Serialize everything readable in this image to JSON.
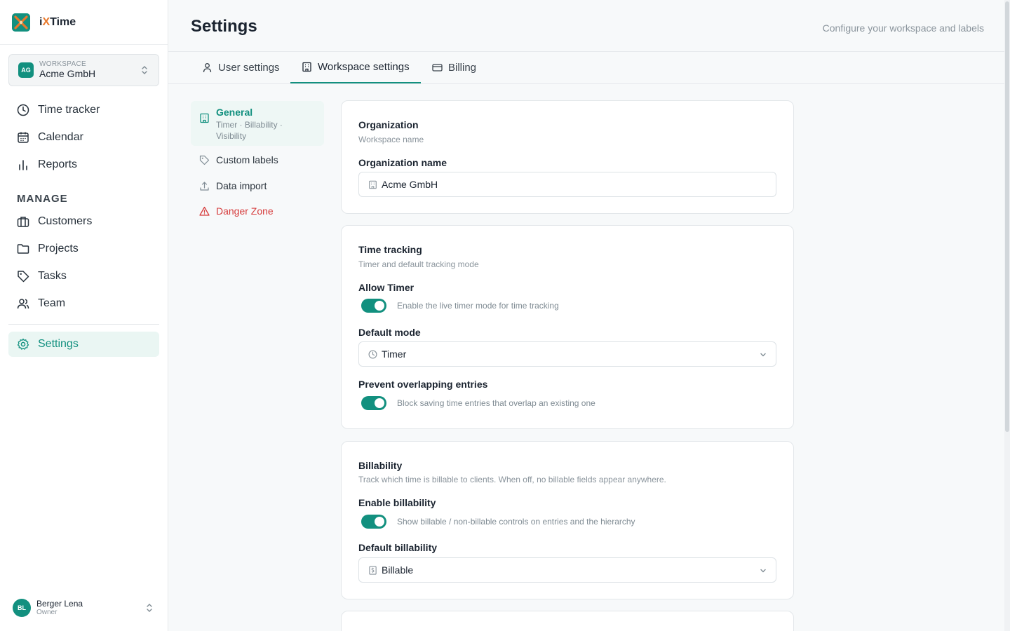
{
  "brand": {
    "name_prefix": "i",
    "name_x": "X",
    "name_suffix": "Time"
  },
  "workspace": {
    "caption": "WORKSPACE",
    "name": "Acme GmbH",
    "initials": "AG"
  },
  "nav": {
    "items": [
      {
        "label": "Time tracker",
        "icon": "clock-icon"
      },
      {
        "label": "Calendar",
        "icon": "calendar-icon"
      },
      {
        "label": "Reports",
        "icon": "bar-chart-icon"
      }
    ],
    "manage_title": "MANAGE",
    "manage_items": [
      {
        "label": "Customers",
        "icon": "briefcase-icon"
      },
      {
        "label": "Projects",
        "icon": "folder-icon"
      },
      {
        "label": "Tasks",
        "icon": "tag-icon"
      },
      {
        "label": "Team",
        "icon": "users-icon"
      }
    ],
    "settings": {
      "label": "Settings",
      "icon": "gear-icon",
      "active": true
    }
  },
  "user": {
    "name": "Berger Lena",
    "role": "Owner",
    "initials": "BL"
  },
  "header": {
    "title": "Settings",
    "subtitle": "Configure your workspace and labels"
  },
  "tabs": [
    {
      "label": "User settings",
      "icon": "user-icon"
    },
    {
      "label": "Workspace settings",
      "icon": "building-icon",
      "active": true
    },
    {
      "label": "Billing",
      "icon": "credit-card-icon"
    }
  ],
  "subnav": {
    "general": {
      "label": "General",
      "desc": "Timer · Billability · Visibility"
    },
    "custom_labels": {
      "label": "Custom labels"
    },
    "data_import": {
      "label": "Data import"
    },
    "danger_zone": {
      "label": "Danger Zone"
    }
  },
  "organization": {
    "title": "Organization",
    "subtitle": "Workspace name",
    "field_label": "Organization name",
    "value": "Acme GmbH"
  },
  "time_tracking": {
    "title": "Time tracking",
    "subtitle": "Timer and default tracking mode",
    "allow_timer": {
      "label": "Allow Timer",
      "desc": "Enable the live timer mode for time tracking",
      "on": true
    },
    "default_mode": {
      "label": "Default mode",
      "value": "Timer"
    },
    "prevent_overlap": {
      "label": "Prevent overlapping entries",
      "desc": "Block saving time entries that overlap an existing one",
      "on": true
    }
  },
  "billability": {
    "title": "Billability",
    "subtitle": "Track which time is billable to clients. When off, no billable fields appear anywhere.",
    "enable": {
      "label": "Enable billability",
      "desc": "Show billable / non-billable controls on entries and the hierarchy",
      "on": true
    },
    "default": {
      "label": "Default billability",
      "value": "Billable"
    }
  },
  "colors": {
    "accent": "#12907f",
    "accent_bg": "#eaf6f3",
    "danger": "#d63b3b",
    "logo_orange": "#e8782a"
  }
}
